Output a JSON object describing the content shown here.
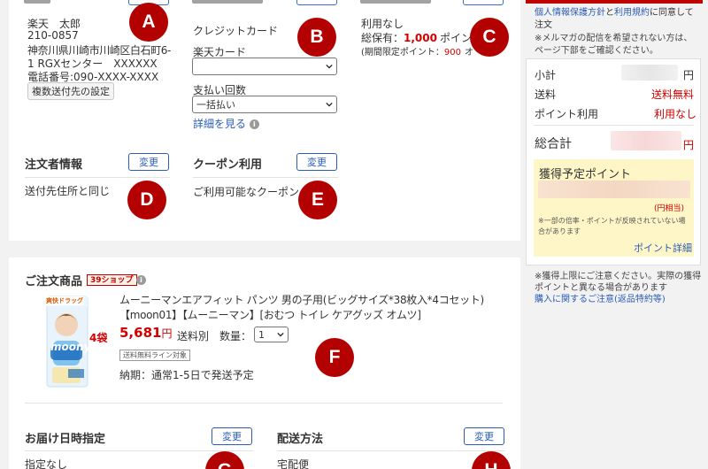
{
  "shipping": {
    "name": "楽天　太郎",
    "zip": "210-0857",
    "address1": "神奈川県川崎市川崎区白石町6-",
    "address2": "1 RGXセンター　XXXXXX",
    "phone": "電話番号:090-XXXX-XXXX",
    "multi_button": "複数送付先の設定"
  },
  "payment": {
    "method": "クレジットカード",
    "card_label": "楽天カード",
    "card_value": "",
    "installments_label": "支払い回数",
    "installments_value": "一括払い",
    "detail_link": "詳細を見る"
  },
  "points_use": {
    "status": "利用なし",
    "total_label": "総保有：",
    "total_value": "1,000",
    "total_unit": "ポイン",
    "limited_label": "(期間限定ポイント：",
    "limited_value": "900",
    "limited_unit": "オ"
  },
  "orderer": {
    "title": "注文者情報",
    "change": "変更",
    "value": "送付先住所と同じ"
  },
  "coupon": {
    "title": "クーポン利用",
    "change": "変更",
    "value": "ご利用可能なクーポン"
  },
  "product_section": {
    "title": "ご注文商品",
    "shop_badge": "39ショップ",
    "product_name_line1": "ムーニーマンエアフィット パンツ 男の子用(ビッグサイズ*38枚入*4コセット)",
    "product_name_line2": "【moon01】【ムーニーマン】[おむつ トイレ ケアグッズ オムツ]",
    "price": "5,681",
    "price_unit": "円",
    "shipping_note": "送料別",
    "qty_label": "数量：",
    "qty_value": "1",
    "free_ship_tag": "送料無料ライン対象",
    "delivery": "納期：通常1-5日で発送予定",
    "pack_count": "4袋",
    "pack_brand": "moony",
    "pack_store": "爽快ドラッグ"
  },
  "delivery_date": {
    "title": "お届け日時指定",
    "change": "変更",
    "value": "指定なし"
  },
  "delivery_method": {
    "title": "配送方法",
    "change": "変更",
    "value": "宅配便"
  },
  "sidebar": {
    "notice_link1": "個人情報保護方針",
    "notice_mid": "と",
    "notice_link2": "利用規約",
    "notice_tail1": "に同意して",
    "notice_tail2": "注文",
    "mail_note1": "※メルマガの配信を希望されない方は、",
    "mail_note2": "ページ下部をご確認ください。",
    "subtotal_label": "小計",
    "subtotal_unit": "円",
    "shipping_label": "送料",
    "shipping_value": "送料無料",
    "points_label": "ポイント利用",
    "points_value": "利用なし",
    "total_label": "総合計",
    "total_unit": "円",
    "earn_title": "獲得予定ポイント",
    "earn_unit": "(円相当)",
    "earn_note1": "※一部の倍率・ポイントが反映されていない場",
    "earn_note2": "合があります",
    "earn_link": "ポイント詳細",
    "bottom_note1": "※獲得上限にご注意ください。実際の獲得",
    "bottom_note2": "ポイントと異なる場合があります",
    "bottom_link": "購入に関するご注意(返品特約等)"
  },
  "markers": [
    "A",
    "B",
    "C",
    "D",
    "E",
    "F",
    "G",
    "H"
  ],
  "colors": {
    "accent_blue": "#2b5db8",
    "price_red": "#d40000",
    "marker_red": "#b30000",
    "earn_bg": "#fff6c8"
  }
}
